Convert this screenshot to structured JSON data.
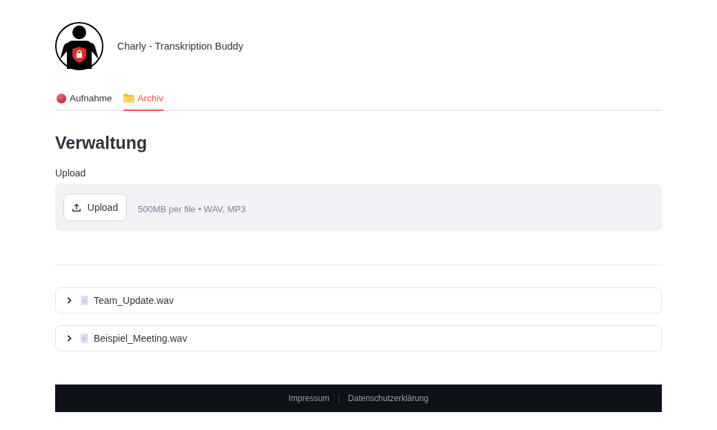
{
  "header": {
    "title": "Charly - Transkription Buddy"
  },
  "tabs": [
    {
      "label": "Aufnahme",
      "selected": false
    },
    {
      "label": "Archiv",
      "selected": true
    }
  ],
  "section": {
    "heading": "Verwaltung",
    "upload": {
      "label": "Upload",
      "button": "Upload",
      "hint": "500MB per file • WAV, MP3"
    }
  },
  "files": [
    {
      "name": "Team_Update.wav",
      "expanded": false
    },
    {
      "name": "Beispiel_Meeting.wav",
      "expanded": false
    }
  ],
  "footer": {
    "links": [
      "Impressum",
      "Datenschutzerklärung"
    ]
  }
}
